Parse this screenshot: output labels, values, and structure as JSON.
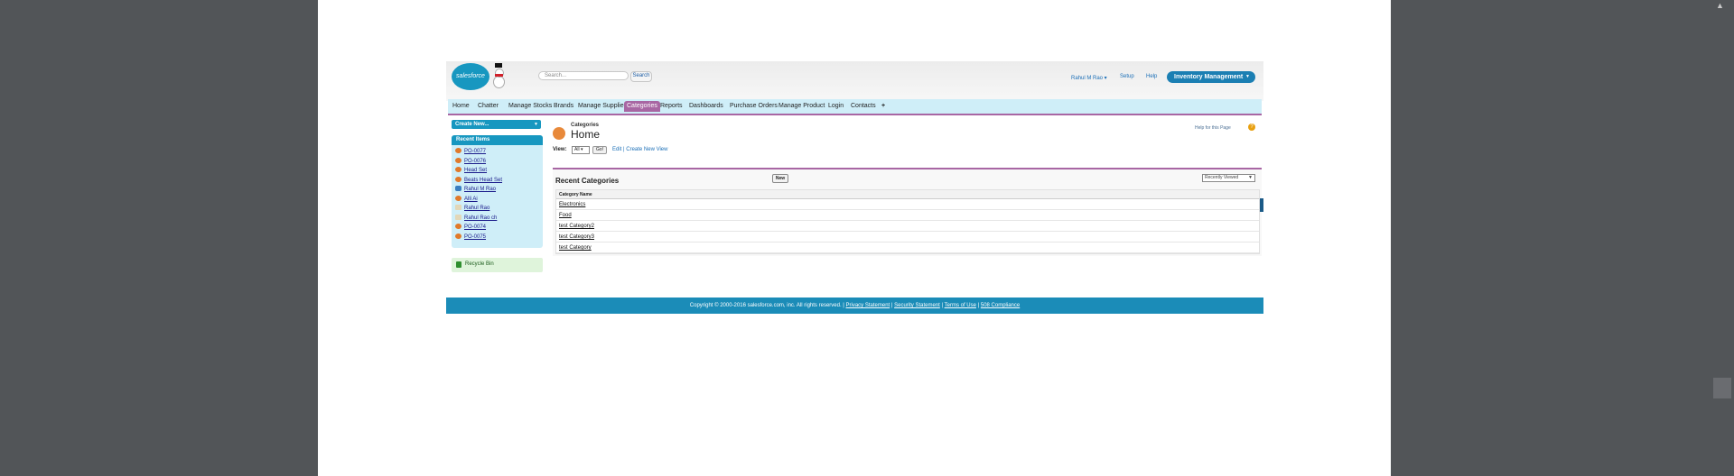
{
  "header": {
    "logo_text": "salesforce",
    "search_placeholder": "Search...",
    "search_button": "Search",
    "user_menu": "Rahul M Rao ▾",
    "setup": "Setup",
    "help": "Help",
    "app_menu": "Inventory Management"
  },
  "tabs": [
    {
      "label": "Home"
    },
    {
      "label": "Chatter"
    },
    {
      "label": "Manage Stocks"
    },
    {
      "label": "Brands"
    },
    {
      "label": "Manage Suppliers"
    },
    {
      "label": "Categories"
    },
    {
      "label": "Reports"
    },
    {
      "label": "Dashboards"
    },
    {
      "label": "Purchase Orders"
    },
    {
      "label": "Manage Product"
    },
    {
      "label": "Login"
    },
    {
      "label": "Contacts"
    },
    {
      "label": "+"
    }
  ],
  "active_tab": "Categories",
  "sidebar": {
    "create_new": "Create New...",
    "recent_title": "Recent Items",
    "recent_items": [
      {
        "label": "PO-0077",
        "icon": "order-icon"
      },
      {
        "label": "PO-0076",
        "icon": "order-icon"
      },
      {
        "label": "Head Set",
        "icon": "product-icon"
      },
      {
        "label": "Beats Head Set",
        "icon": "product-icon"
      },
      {
        "label": "Rahul M Rao",
        "icon": "user-icon"
      },
      {
        "label": "Alli Ai",
        "icon": "order-icon"
      },
      {
        "label": "Rahul Rao",
        "icon": "contact-icon"
      },
      {
        "label": "Rahul Rao ch",
        "icon": "contact-icon"
      },
      {
        "label": "PO-0074",
        "icon": "order-icon"
      },
      {
        "label": "PO-0075",
        "icon": "order-icon"
      }
    ],
    "recycle_bin": "Recycle Bin"
  },
  "main": {
    "page_type": "Categories",
    "page_title": "Home",
    "help_link": "Help for this Page",
    "view_label": "View:",
    "view_value": "All ▾",
    "go_button": "Go!",
    "view_links": "Edit | Create New View",
    "recent_title": "Recent Categories",
    "new_button": "New",
    "recent_filter": "Recently Viewed",
    "table": {
      "column": "Category Name",
      "rows": [
        "Electronics",
        "Food",
        "test Category2",
        "test Category3",
        "test Category"
      ]
    }
  },
  "footer": {
    "copyright": "Copyright © 2000-2016 salesforce.com, inc. All rights reserved. |",
    "links": [
      "Privacy Statement",
      "Security Statement",
      "Terms of Use",
      "508 Compliance"
    ]
  },
  "colors": {
    "brand_blue": "#1797c0",
    "active_tab": "#a866a3",
    "tab_bar": "#cfeef8",
    "background_gray": "#525558"
  }
}
